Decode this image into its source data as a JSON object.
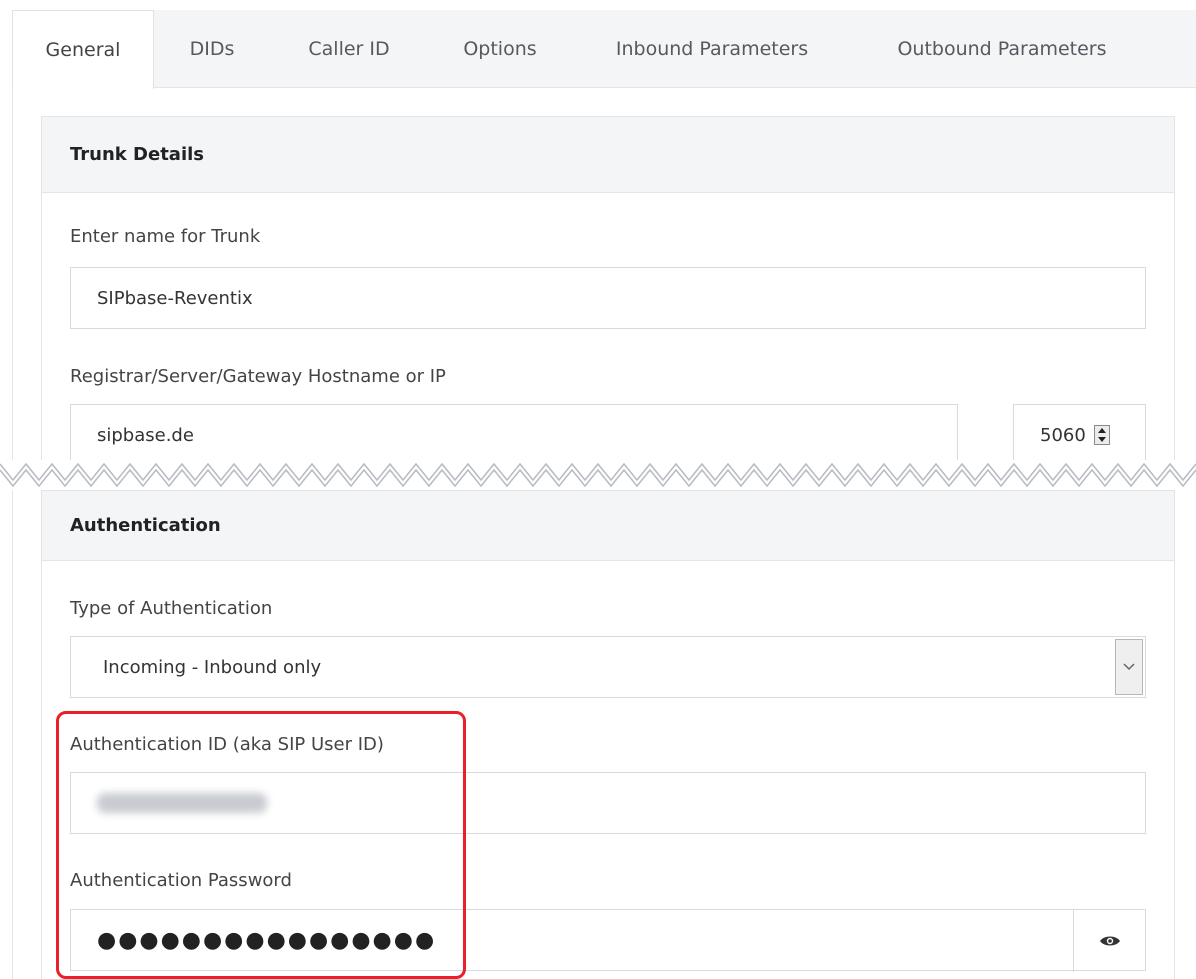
{
  "tabs": [
    {
      "label": "General",
      "active": true
    },
    {
      "label": "DIDs",
      "active": false
    },
    {
      "label": "Caller ID",
      "active": false
    },
    {
      "label": "Options",
      "active": false
    },
    {
      "label": "Inbound Parameters",
      "active": false
    },
    {
      "label": "Outbound Parameters",
      "active": false
    }
  ],
  "trunk_details": {
    "heading": "Trunk Details",
    "name_label": "Enter name for Trunk",
    "name_value": "SIPbase-Reventix",
    "host_label": "Registrar/Server/Gateway Hostname or IP",
    "host_value": "sipbase.de",
    "port_value": "5060"
  },
  "authentication": {
    "heading": "Authentication",
    "type_label": "Type of Authentication",
    "type_value": "Incoming - Inbound only",
    "auth_id_label": "Authentication ID (aka SIP User ID)",
    "auth_id_value": "",
    "password_label": "Authentication Password",
    "password_value": "●●●●●●●●●●●●●●●●"
  },
  "colors": {
    "highlight": "#e8202a",
    "tab_bar": "#f4f5f7",
    "border": "#d7dadf"
  },
  "icons": {
    "spinner": "spinner-arrows-icon",
    "dropdown": "chevron-down-icon",
    "reveal": "eye-icon"
  }
}
